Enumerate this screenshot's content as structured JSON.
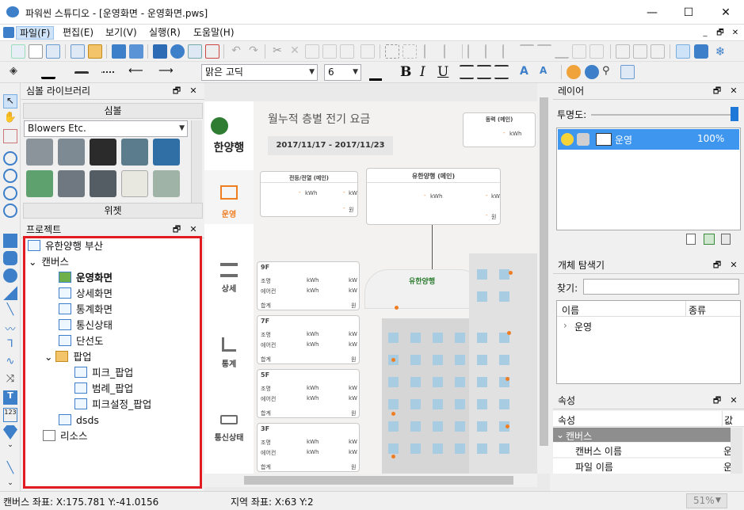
{
  "window": {
    "title": "파워씬 스튜디오 - [운영화면 - 운영화면.pws]",
    "minimize": "—",
    "maximize": "☐",
    "close": "✕"
  },
  "menu": {
    "items": [
      "파일(F)",
      "편집(E)",
      "보기(V)",
      "실행(R)",
      "도움말(H)"
    ]
  },
  "mdi_controls": [
    "_",
    "🗗",
    "✕"
  ],
  "toolbar2": {
    "font": "맑은 고딕",
    "size": "6",
    "bold": "B",
    "italic": "I",
    "underline": "U"
  },
  "symbol_library": {
    "title": "심볼 라이브러리",
    "section": "심볼",
    "category": "Blowers Etc.",
    "widget_section": "위젯"
  },
  "project": {
    "title": "프로젝트",
    "root": "유한양행 부산",
    "canvas": "캔버스",
    "screens": [
      "운영화면",
      "상세화면",
      "통계화면",
      "통신상태",
      "단선도"
    ],
    "popup_folder": "팝업",
    "popups": [
      "피크_팝업",
      "범례_팝업",
      "피크설정_팝업"
    ],
    "extra": "dsds",
    "resources": "리소스"
  },
  "nav": {
    "logo": "한양행",
    "items": [
      "운영",
      "상세",
      "통계",
      "통신상태"
    ]
  },
  "canvas": {
    "heading": "월누적 층별 전기 요금",
    "date_range": "2017/11/17 - 2017/11/23",
    "main_card_title": "유한양행 (메인)",
    "left_card_title": "전등/전열 (메인)",
    "right_card_title": "동력 (메인)",
    "unit_kwh": "kWh",
    "unit_kw": "kW",
    "unit_won": "원",
    "dash": "-",
    "logo_text": "유한양행",
    "floors": [
      {
        "name": "9F"
      },
      {
        "name": "7F"
      },
      {
        "name": "5F"
      },
      {
        "name": "3F"
      }
    ],
    "floor_rows": [
      "조명",
      "에어컨",
      "합계"
    ]
  },
  "layer": {
    "title": "레이어",
    "opacity_label": "투명도:",
    "layer_name": "운영",
    "layer_pct": "100%"
  },
  "explorer": {
    "title": "개체 탐색기",
    "search_label": "찾기:",
    "col_name": "이름",
    "col_type": "종류",
    "item": "운영"
  },
  "properties": {
    "title": "속성",
    "col": "속성",
    "col2": "값",
    "group": "캔버스",
    "rows": [
      "캔버스 이름",
      "파일 이름"
    ],
    "vals": [
      "운",
      "운"
    ]
  },
  "status": {
    "canvas_coord": "캔버스 좌표: X:175.781 Y:-41.0156",
    "area_coord": "지역 좌표: X:63 Y:2",
    "zoom": "51%"
  },
  "colors": {
    "accent": "#3d7fc9",
    "highlight": "#e21b23",
    "orange": "#ef7d22",
    "nav_active": "#ef7d22"
  }
}
